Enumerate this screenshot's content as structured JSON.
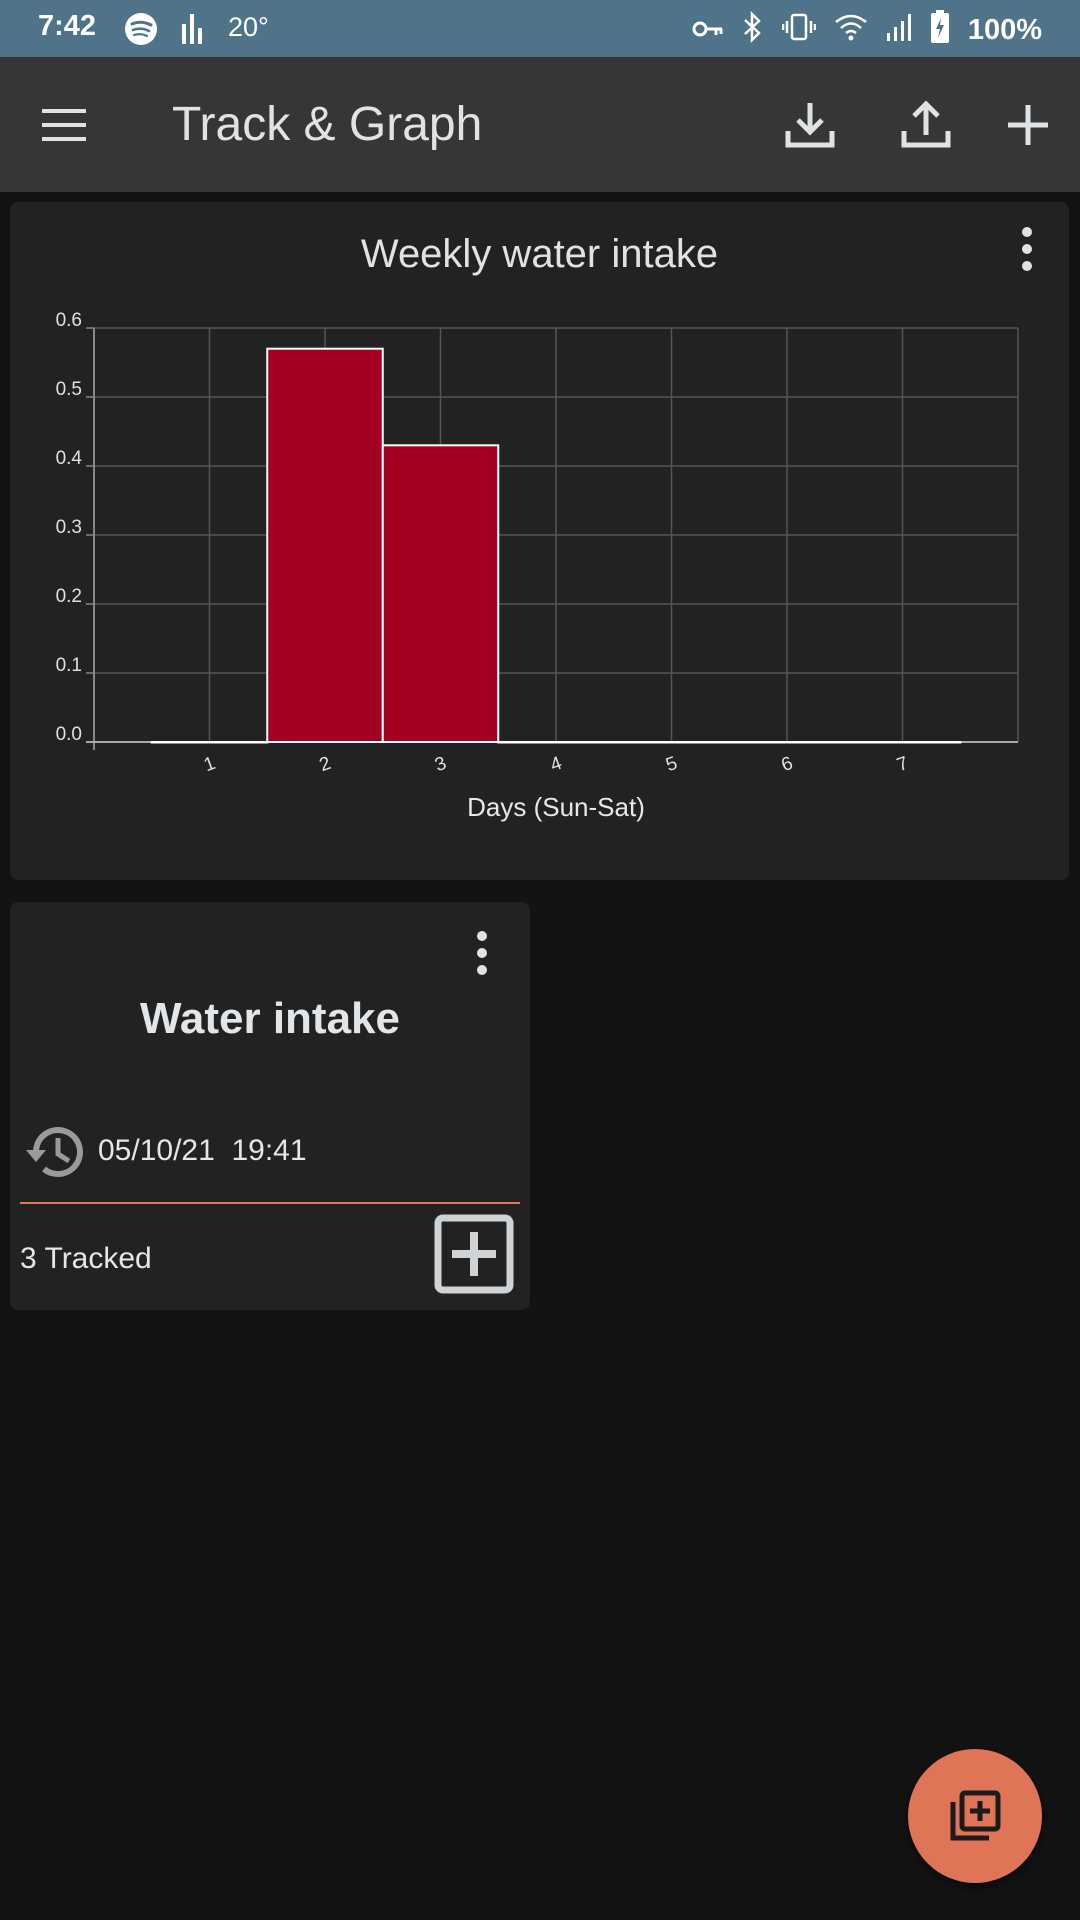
{
  "status_bar": {
    "time": "7:42",
    "temperature": "20°",
    "battery": "100%",
    "icons": [
      "spotify-icon",
      "equalizer-icon",
      "vpn-key-icon",
      "bluetooth-icon",
      "vibrate-icon",
      "wifi-icon",
      "signal-icon",
      "battery-charging-icon"
    ]
  },
  "app_bar": {
    "title": "Track & Graph",
    "icons": [
      "menu-icon",
      "import-icon",
      "export-icon",
      "add-icon"
    ]
  },
  "graph_card": {
    "title": "Weekly water intake",
    "menu_icon": "more-vert-icon"
  },
  "chart_data": {
    "type": "bar",
    "title": "Weekly water intake",
    "xlabel": "Days (Sun-Sat)",
    "ylabel": "",
    "categories": [
      "1",
      "2",
      "3",
      "4",
      "5",
      "6",
      "7"
    ],
    "values": [
      0,
      0.57,
      0.43,
      0,
      0,
      0,
      0
    ],
    "ylim": [
      0,
      0.6
    ],
    "yticks": [
      "0.0",
      "0.1",
      "0.2",
      "0.3",
      "0.4",
      "0.5",
      "0.6"
    ],
    "grid": true,
    "bar_color": "#a30023",
    "bar_border": "#ffffff"
  },
  "tracker_card": {
    "name": "Water intake",
    "last_time": "05/10/21  19:41",
    "tracked": "3 Tracked",
    "accent": "#e07a57",
    "icons": [
      "history-icon",
      "more-vert-icon",
      "add-box-icon"
    ]
  },
  "fab": {
    "icon": "library-add-icon",
    "color": "#e07456"
  }
}
